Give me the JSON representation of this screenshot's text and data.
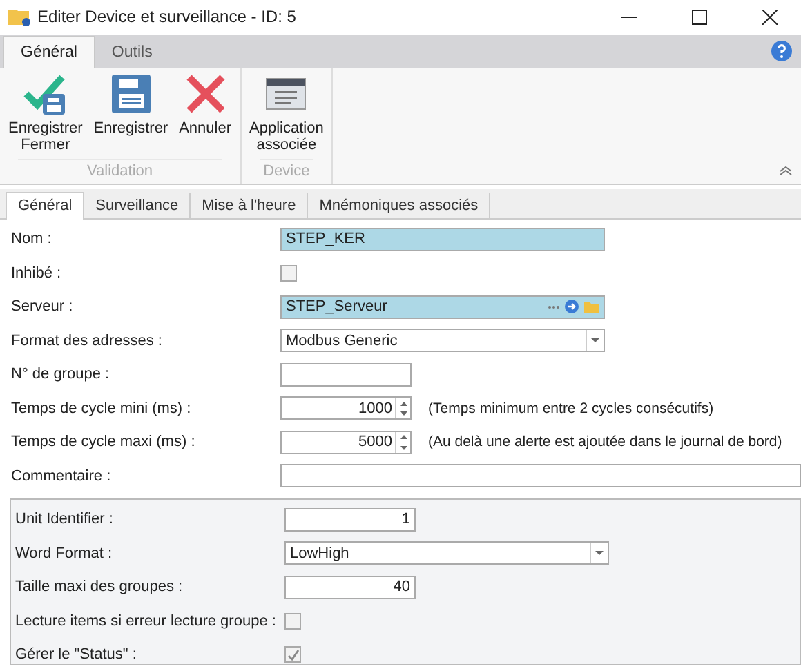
{
  "window": {
    "title": "Editer Device et surveillance - ID: 5"
  },
  "ribbon": {
    "tabs": [
      {
        "label": "Général",
        "selected": true
      },
      {
        "label": "Outils",
        "selected": false
      }
    ],
    "groups": [
      {
        "label": "Validation",
        "buttons": [
          {
            "kind": "save-close",
            "label": "Enregistrer Fermer"
          },
          {
            "kind": "save",
            "label": "Enregistrer"
          },
          {
            "kind": "cancel",
            "label": "Annuler"
          }
        ]
      },
      {
        "label": "Device",
        "buttons": [
          {
            "kind": "app",
            "label": "Application associée"
          }
        ]
      }
    ]
  },
  "tabs": [
    {
      "label": "Général",
      "selected": true
    },
    {
      "label": "Surveillance",
      "selected": false
    },
    {
      "label": "Mise à l'heure",
      "selected": false
    },
    {
      "label": "Mnémoniques associés",
      "selected": false
    }
  ],
  "fields": [
    {
      "kind": "text",
      "label": "Nom :",
      "value": "STEP_KER",
      "highlighted": true
    },
    {
      "kind": "checkbox",
      "label": "Inhibé :",
      "checked": false
    },
    {
      "kind": "lookup",
      "label": "Serveur :",
      "value": "STEP_Serveur",
      "highlighted": true
    },
    {
      "kind": "dropdown",
      "label": "Format des adresses :",
      "value": "Modbus Generic"
    },
    {
      "kind": "short-text",
      "label": "N° de groupe :",
      "highlighted": false
    },
    {
      "kind": "spin",
      "label": "Temps de cycle mini (ms) :",
      "value": "1000",
      "hint": "(Temps minimum entre 2 cycles consécutifs)"
    },
    {
      "kind": "spin",
      "label": "Temps de cycle maxi (ms) :",
      "value": "5000",
      "hint": "(Au delà une alerte est ajoutée dans le journal de bord)"
    },
    {
      "kind": "wide-text",
      "label": "Commentaire :",
      "highlighted": false
    }
  ],
  "protocol_fields": [
    {
      "kind": "number",
      "label": "Unit Identifier :",
      "value": "1"
    },
    {
      "kind": "dropdown",
      "label": "Word Format :",
      "value": "LowHigh"
    },
    {
      "kind": "number",
      "label": "Taille maxi des groupes :",
      "value": "40"
    },
    {
      "kind": "checkbox",
      "label": "Lecture items si erreur lecture groupe :",
      "checked": false
    },
    {
      "kind": "checkbox",
      "label": "Gérer le \"Status\" :",
      "checked": true
    }
  ]
}
